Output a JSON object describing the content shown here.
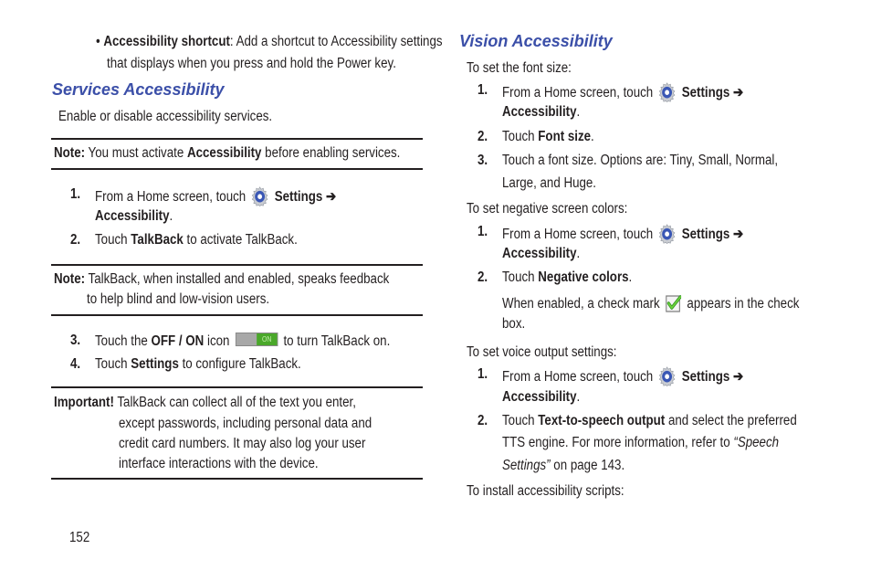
{
  "left": {
    "bullet": {
      "bold": "Accessibility shortcut",
      "text1": ": Add a shortcut to Accessibility settings",
      "text2": "that displays when you press and hold the Power key."
    },
    "heading": "Services Accessibility",
    "intro": "Enable or disable accessibility services.",
    "note1": {
      "label": "Note:",
      "pre": " You must activate ",
      "bold": "Accessibility",
      "post": " before enabling services."
    },
    "steps_a": [
      {
        "num": "1.",
        "pre": "From a Home screen, touch ",
        "icon": "settings-gear-icon",
        "bold": "Settings ➔",
        "line2_bold": "Accessibility",
        "line2_post": "."
      },
      {
        "num": "2.",
        "pre": "Touch ",
        "bold": "TalkBack",
        "post": " to activate TalkBack."
      }
    ],
    "note2": {
      "label": "Note:",
      "line1": " TalkBack, when installed and enabled, speaks feedback",
      "line2": "to help blind and low-vision users."
    },
    "steps_b": [
      {
        "num": "3.",
        "pre": "Touch the ",
        "bold": "OFF / ON",
        "mid": " icon ",
        "toggle_label": "ON",
        "post": " to turn TalkBack on."
      },
      {
        "num": "4.",
        "pre": "Touch ",
        "bold": "Settings",
        "post": " to configure TalkBack."
      }
    ],
    "important": {
      "label": "Important!",
      "lines": [
        " TalkBack can collect all of the text you enter,",
        "except passwords, including personal data and",
        "credit card numbers. It may also log your user",
        "interface interactions with the device."
      ]
    },
    "page_number": "152"
  },
  "right": {
    "heading": "Vision Accessibility",
    "font_intro": "To set the font size:",
    "font_steps": [
      {
        "num": "1.",
        "pre": "From a Home screen, touch ",
        "bold": "Settings ➔",
        "line2_bold": "Accessibility",
        "line2_post": "."
      },
      {
        "num": "2.",
        "pre": "Touch ",
        "bold": "Font size",
        "post": "."
      },
      {
        "num": "3.",
        "line1": "Touch a font size. Options are: Tiny, Small, Normal,",
        "line2": "Large, and Huge."
      }
    ],
    "neg_intro": "To set negative screen colors:",
    "neg_steps": [
      {
        "num": "1.",
        "pre": "From a Home screen, touch ",
        "bold": "Settings ➔",
        "line2_bold": "Accessibility",
        "line2_post": "."
      },
      {
        "num": "2.",
        "pre": "Touch ",
        "bold": "Negative colors",
        "post": "."
      }
    ],
    "neg_note": {
      "pre": "When enabled, a check mark ",
      "post": " appears in the check",
      "line2": "box."
    },
    "voice_intro": "To set voice output settings:",
    "voice_steps": [
      {
        "num": "1.",
        "pre": "From a Home screen, touch ",
        "bold": "Settings ➔",
        "line2_bold": "Accessibility",
        "line2_post": "."
      },
      {
        "num": "2.",
        "pre": "Touch ",
        "bold": "Text-to-speech output",
        "post": " and select the preferred",
        "line2": "TTS engine. For more information, refer to ",
        "line2_italic": "“Speech",
        "line3_italic": "Settings”",
        "line3_post": " on page 143."
      }
    ],
    "scripts_intro": "To install accessibility scripts:"
  },
  "colors": {
    "heading": "#3b4fa8",
    "toggle_on": "#4aa82a",
    "check": "#4db82a"
  }
}
